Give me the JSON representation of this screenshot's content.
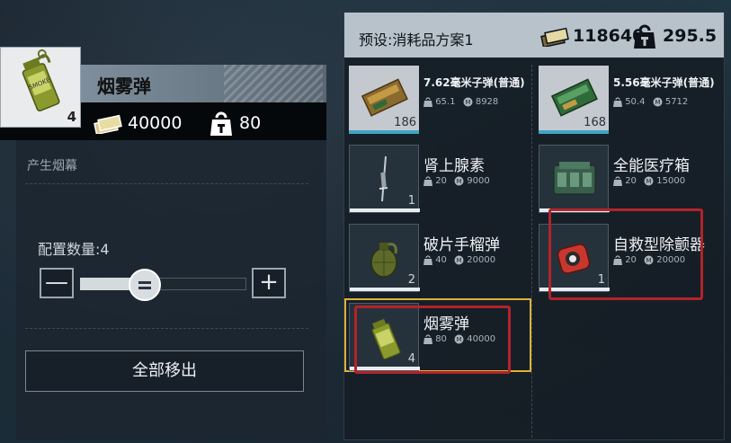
{
  "detail": {
    "title": "烟雾弹",
    "quantity_badge": "4",
    "cost": "40000",
    "weight": "80",
    "description": "产生烟幕",
    "config_label": "配置数量:4",
    "config_value": 4,
    "config_max": 10,
    "minus_label": "—",
    "plus_label": "+",
    "remove_all_label": "全部移出"
  },
  "preset": {
    "title": "预设:消耗品方案1",
    "total_cost": "118640",
    "total_weight": "295.5"
  },
  "items": [
    {
      "name": "7.62毫米子弹(普通)",
      "count": "186",
      "weight": "65.1",
      "price": "8928",
      "style": "ammo-762"
    },
    {
      "name": "5.56毫米子弹(普通)",
      "count": "168",
      "weight": "50.4",
      "price": "5712",
      "style": "ammo-556"
    },
    {
      "name": "肾上腺素",
      "count": "1",
      "weight": "20",
      "price": "9000",
      "style": "syringe"
    },
    {
      "name": "全能医疗箱",
      "count": "",
      "weight": "20",
      "price": "15000",
      "style": "medkit"
    },
    {
      "name": "破片手榴弹",
      "count": "2",
      "weight": "40",
      "price": "20000",
      "style": "frag"
    },
    {
      "name": "自救型除颤器",
      "count": "1",
      "weight": "20",
      "price": "20000",
      "style": "defib"
    },
    {
      "name": "烟雾弹",
      "count": "4",
      "weight": "80",
      "price": "40000",
      "style": "smoke"
    }
  ],
  "colors": {
    "selection": "#e0b23a",
    "highlight": "#b3232a",
    "ammo_bar": "#3fa4c4"
  }
}
